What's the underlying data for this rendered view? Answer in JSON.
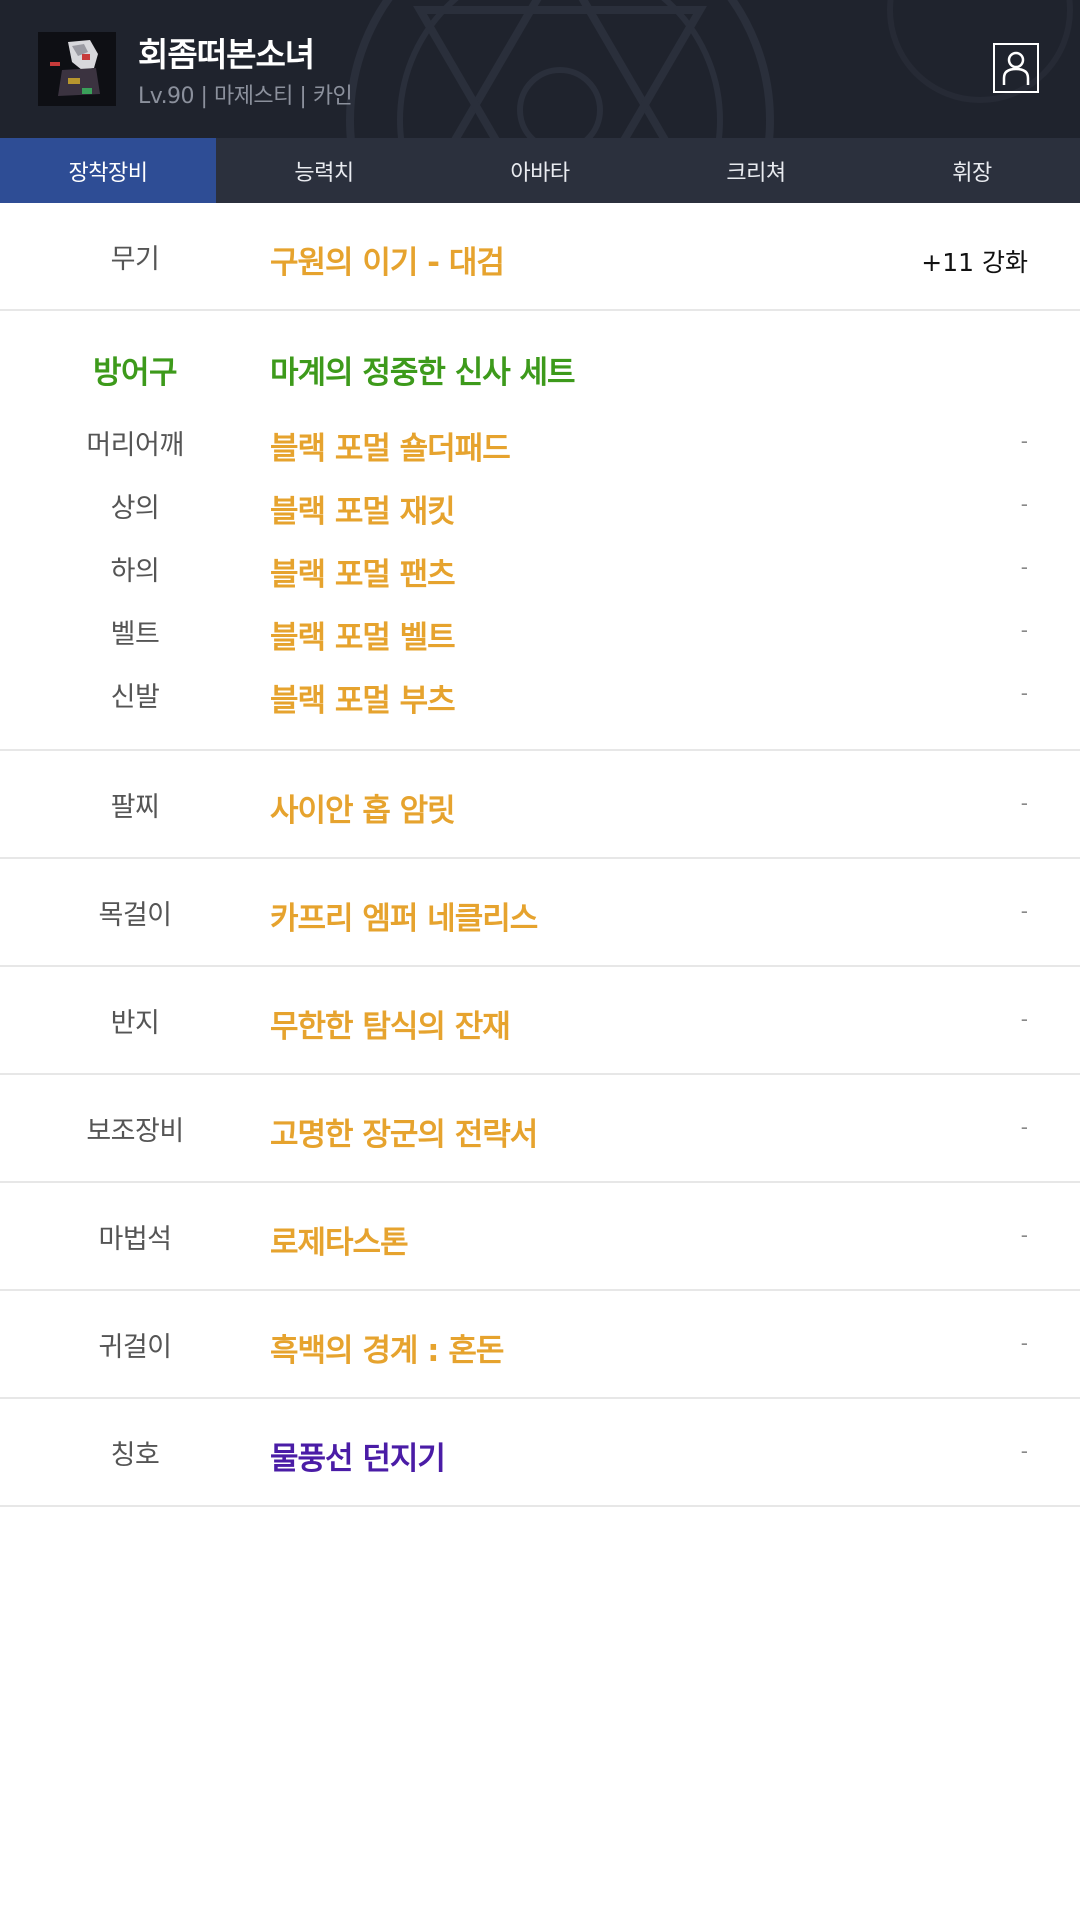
{
  "character": {
    "name": "회좀떠본소녀",
    "info": "Lv.90 | 마제스티 | 카인"
  },
  "tabs": [
    "장착장비",
    "능력치",
    "아바타",
    "크리쳐",
    "휘장"
  ],
  "weapon": {
    "slot": "무기",
    "item": "구원의 이기 - 대검",
    "enhance": "+11 강화"
  },
  "armor": {
    "slot": "방어구",
    "set_name": "마계의 정중한 신사 세트",
    "pieces": [
      {
        "slot": "머리어깨",
        "item": "블랙 포멀 숄더패드",
        "value": "-"
      },
      {
        "slot": "상의",
        "item": "블랙 포멀 재킷",
        "value": "-"
      },
      {
        "slot": "하의",
        "item": "블랙 포멀 팬츠",
        "value": "-"
      },
      {
        "slot": "벨트",
        "item": "블랙 포멀 벨트",
        "value": "-"
      },
      {
        "slot": "신발",
        "item": "블랙 포멀 부츠",
        "value": "-"
      }
    ]
  },
  "accessories": [
    {
      "slot": "팔찌",
      "item": "사이안 홉 암릿",
      "value": "-"
    },
    {
      "slot": "목걸이",
      "item": "카프리 엠퍼 네클리스",
      "value": "-"
    },
    {
      "slot": "반지",
      "item": "무한한 탐식의 잔재",
      "value": "-"
    },
    {
      "slot": "보조장비",
      "item": "고명한 장군의 전략서",
      "value": "-"
    },
    {
      "slot": "마법석",
      "item": "로제타스톤",
      "value": "-"
    },
    {
      "slot": "귀걸이",
      "item": "흑백의 경계 : 혼돈",
      "value": "-"
    },
    {
      "slot": "칭호",
      "item": "물풍선 던지기",
      "value": "-"
    }
  ],
  "colors": {
    "header_bg": "#1f232d",
    "tab_active": "#2e4d95",
    "item_gold": "#e6a32e",
    "set_green": "#3d9a1b",
    "title_purple": "#4a1ca6"
  },
  "icons": {
    "profile": "person-icon"
  }
}
